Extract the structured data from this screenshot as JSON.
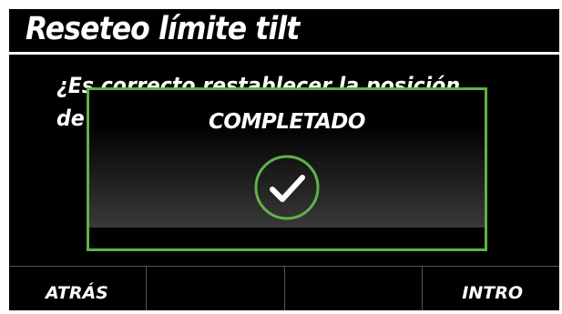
{
  "header": {
    "title": "Reseteo límite tilt"
  },
  "main": {
    "question": "¿Es correcto restablecer la posición\nde"
  },
  "dialog": {
    "message": "COMPLETADO",
    "icon": "check-circle-icon",
    "accent_color": "#5fb24a"
  },
  "softkeys": {
    "back_label": "ATRÁS",
    "key2_label": "",
    "key3_label": "",
    "enter_label": "INTRO"
  }
}
